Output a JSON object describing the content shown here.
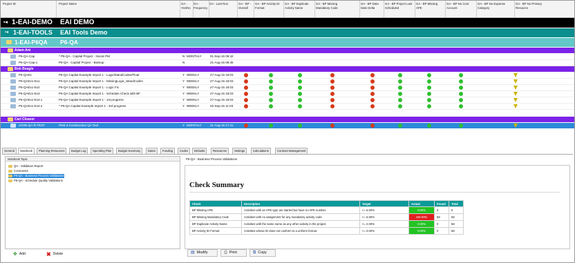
{
  "columns": {
    "project_id": "Project ID",
    "project_name": "Project Name",
    "c1": "GA - Yes/No",
    "c2": "GA - Frequency",
    "c3": "GA - Last Run",
    "c4": "GA - BP - Overall",
    "c5": "GA - BP Activity ID Format",
    "c6": "GA - BP Duplicate Activity Name",
    "c7": "GA - BP Missing Mandatory Code",
    "c8": "GA - BP Data Date Delta",
    "c9": "GA - BP Project Last Scheduled",
    "c10": "GA - BP Missing APE",
    "c11": "GA - BP No Cost Account",
    "c12": "GA - BP No Expense Category",
    "c13": "GA - BP No Primary Resource"
  },
  "tree": {
    "demo_id": "1-EAI-DEMO",
    "demo_name": "EAI DEMO",
    "tools_id": "1-EAI-TOOLS",
    "tools_name": "EAI Tools Demo",
    "p6qa_id": "1-EAI-P6QA",
    "p6qa_name": "P6-QA",
    "groups": [
      {
        "name": "Adam Ant"
      },
      {
        "name": "Bob Beagle"
      },
      {
        "name": "Carl Cleaver"
      }
    ],
    "rows_adam": [
      {
        "id": "P6-QA-Cap",
        "name": "* P6-QA - Capital Project - Nicole PM",
        "yn": "N",
        "freq": "MONTHLY",
        "last": "01-Sep-15 09:42"
      },
      {
        "id": "P6-QA-Cap-1",
        "name": "P6-QA - Capital Project - Backup",
        "yn": "N",
        "freq": "",
        "last": "21-Aug-15 08:46"
      }
    ],
    "rows_bob": [
      {
        "id": "P6-QAEx",
        "name": "P6-QA Capital Example Import 1 - Logic/MandCodes/Float",
        "yn": "Y",
        "freq": "WEEKLY",
        "last": "27-Aug-15 18:03"
      },
      {
        "id": "P6-QAEx1-Ex1",
        "name": "P6-QA Capital Example Import 1 - MissingLogic_MandCodes",
        "yn": "Y",
        "freq": "WEEKLY",
        "last": "27-Aug-15 18:03"
      },
      {
        "id": "P6-QAEx1-Ex2",
        "name": "P6-QA Capital Example Import 1 - Logic Fix",
        "yn": "Y",
        "freq": "WEEKLY",
        "last": "27-Aug-15 18:03"
      },
      {
        "id": "P6-QAEx1-Ex3",
        "name": "P6-QA Capital Example Import 1 - Schedule Check with BF",
        "yn": "Y",
        "freq": "WEEKLY",
        "last": "27-Aug-15 18:03"
      },
      {
        "id": "P6-QAEx1-Ex3.1",
        "name": "P6-QA Capital Example Import 1 - 1st progress",
        "yn": "Y",
        "freq": "WEEKLY",
        "last": "27-Aug-15 18:03"
      },
      {
        "id": "P6-QAEx1-Ex3.2",
        "name": "* P6-QA Capital Example Import 1 - 3rd progress",
        "yn": "Y",
        "freq": "WEEKLY",
        "last": "02-Sep-15 11:03"
      }
    ],
    "rows_carl": [
      {
        "id": "JOHN-QA-R-TEST",
        "name": "PM4-4-Construction QA Tool",
        "yn": "Y",
        "freq": "MONTHLY",
        "last": "21-Aug-15 17:41"
      }
    ],
    "status_bob": [
      [
        "red",
        "green",
        "green",
        "red",
        "red",
        "green",
        "green",
        "green",
        "yellow"
      ],
      [
        "red",
        "green",
        "green",
        "red",
        "red",
        "green",
        "green",
        "green",
        "yellow"
      ],
      [
        "red",
        "green",
        "green",
        "red",
        "red",
        "green",
        "green",
        "green",
        "yellow"
      ],
      [
        "red",
        "green",
        "green",
        "red",
        "red",
        "green",
        "green",
        "green",
        "yellow"
      ],
      [
        "red",
        "green",
        "green",
        "red",
        "red",
        "green",
        "green",
        "green",
        "yellow"
      ],
      [
        "red",
        "green",
        "green",
        "red",
        "red",
        "green",
        "green",
        "green",
        "yellow"
      ]
    ],
    "status_carl": [
      "red",
      "green",
      "green",
      "red",
      "red",
      "green",
      "green",
      "green",
      "yellow"
    ]
  },
  "tabs": [
    "General",
    "Notebook",
    "Planning Resources",
    "Budget Log",
    "Spending Plan",
    "Budget Summary",
    "Dates",
    "Funding",
    "Codes",
    "Defaults",
    "Resources",
    "Settings",
    "Calculations",
    "Contract Management"
  ],
  "active_tab": "Notebook",
  "notebook": {
    "header": "Notebook Topic",
    "items": [
      {
        "label": "QA - Validation Report",
        "selected": false
      },
      {
        "label": "Comments",
        "selected": false
      },
      {
        "label": "P6-QA - Business Process Validations",
        "selected": true
      },
      {
        "label": "P6-QA - Schedule Quality Validations",
        "selected": false
      }
    ],
    "add": "Add",
    "delete": "Delete"
  },
  "detail": {
    "title": "P6-QA - Business Process Validations",
    "heading": "Check Summary",
    "table_headers": [
      "Check",
      "Description",
      "Target",
      "Actual",
      "Found",
      "Total"
    ],
    "rows": [
      {
        "check": "BP Missing APE",
        "desc": "Activities with an APE type are started but have no APE number.",
        "target": "<= 5.00%",
        "actual": "0.00%",
        "actual_color": "#22c322",
        "found": "0",
        "total": "0"
      },
      {
        "check": "BP Missing Mandatory Code",
        "desc": "Activities with no assignment for any mandatory activity code.",
        "target": "<= 5.00%",
        "actual": "100.00%",
        "actual_color": "#e02020",
        "found": "58",
        "total": "58"
      },
      {
        "check": "BP Duplicate Activity Name",
        "desc": "Activities with the same name as any other activity in the project.",
        "target": "<= 2.00%",
        "actual": "0.00%",
        "actual_color": "#22c322",
        "found": "0",
        "total": "58"
      },
      {
        "check": "BP Activity ID Format",
        "desc": "Activities whose ID does not conform to a uniform format.",
        "target": "<= 0.00%",
        "actual": "0.00%",
        "actual_color": "#22c322",
        "found": "0",
        "total": "58"
      }
    ],
    "buttons": {
      "modify": "Modify",
      "print": "Print",
      "copy": "Copy"
    }
  },
  "colors": {
    "green": "#2fbf2f",
    "red": "#d63a1b",
    "yellow": "#d1b800",
    "accent": "#2d8ad8",
    "group": "#7b23e8",
    "teal": "#0a8e8e"
  }
}
